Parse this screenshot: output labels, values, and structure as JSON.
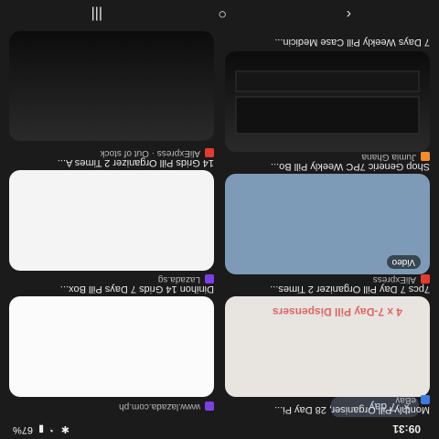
{
  "status": {
    "time": "09:31",
    "icons": [
      "signal-icon",
      "wifi-icon",
      "battery-icon",
      "bluetooth-icon"
    ],
    "battery": "67%"
  },
  "chip": {
    "label": "7 day",
    "close": "×"
  },
  "results": [
    {
      "title": "7 Days Weekly Pill Case Medicin...",
      "source": "",
      "badge": ""
    },
    {
      "title": "Shop Generic 7PC Weekly Pill Bo...",
      "source": "Jumia Ghana",
      "badge": "Video"
    },
    {
      "title": "7pcs 7 Day Pill Organizer 2 Times...",
      "source": "AliExpress",
      "badge": ""
    },
    {
      "title": "Monthly Pill Organiser, 28 Day Pi...",
      "source": "eBay",
      "badge": ""
    },
    {
      "title": "14 Grids Pill Organizer 2 Times A...",
      "source": "AliExpress · Out of stock",
      "badge": ""
    },
    {
      "title": "Dinihon 14 Grids 7 Days Pill Box...",
      "source": "Lazada.sg",
      "badge": ""
    },
    {
      "title": "",
      "source": "www.lazada.com.ph",
      "badge": ""
    }
  ],
  "overlay_text": "4 x 7-Day Pill Dispensers",
  "colors": {
    "bg": "#1b1b1b",
    "chip": "#3a3f4a",
    "link": "#cfe0ff"
  }
}
